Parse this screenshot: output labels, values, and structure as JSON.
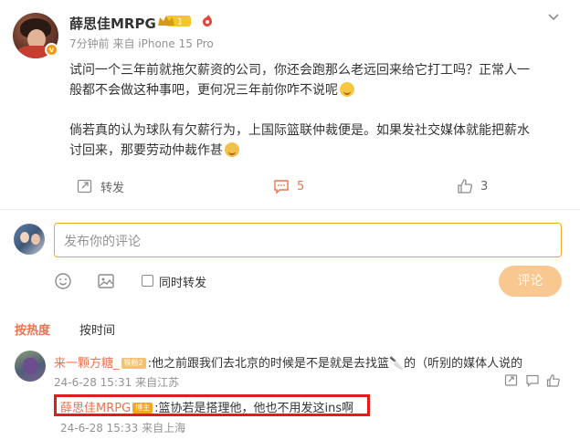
{
  "post": {
    "username": "薛思佳MRPG",
    "level_badge": "1",
    "time": "7分钟前",
    "source": "来自 iPhone 15 Pro",
    "paragraph1_line1": "试问一个三年前就拖欠薪资的公司，你还会跑那么老远回来给它打工吗？正常人一",
    "paragraph1_line2": "般都不会做这种事吧，更何况三年前你咋不说呢",
    "paragraph2_line1": "倘若真的认为球队有欠薪行为，上国际篮联仲裁便是。如果发社交媒体就能把薪水",
    "paragraph2_line2": "讨回来，那要劳动仲裁作甚",
    "actions": {
      "repost_label": "转发",
      "comment_count": "5",
      "like_count": "3"
    }
  },
  "compose": {
    "placeholder": "发布你的评论",
    "repost_checkbox_label": "同时转发",
    "submit_label": "评论"
  },
  "sort_tabs": {
    "hot": "按热度",
    "time": "按时间"
  },
  "comments": [
    {
      "username": "来一颗方糖_",
      "badge": "铁粉2",
      "text": ":他之前跟我们去北京的时候是不是就是去找篮🔪的（听别的媒体人说的",
      "date": "24-6-28 15:31",
      "location": "来自江苏",
      "reply": {
        "username": "薛思佳MRPG",
        "badge": "博主",
        "text": ":篮协若是搭理他，他也不用发这ins啊",
        "date": "24-6-28 15:33",
        "location": "来自上海"
      }
    }
  ],
  "colors": {
    "accent": "#eb7350",
    "highlight_border": "#e31b1b",
    "compose_border": "#f5a623",
    "submit_bg": "#f9c790"
  }
}
